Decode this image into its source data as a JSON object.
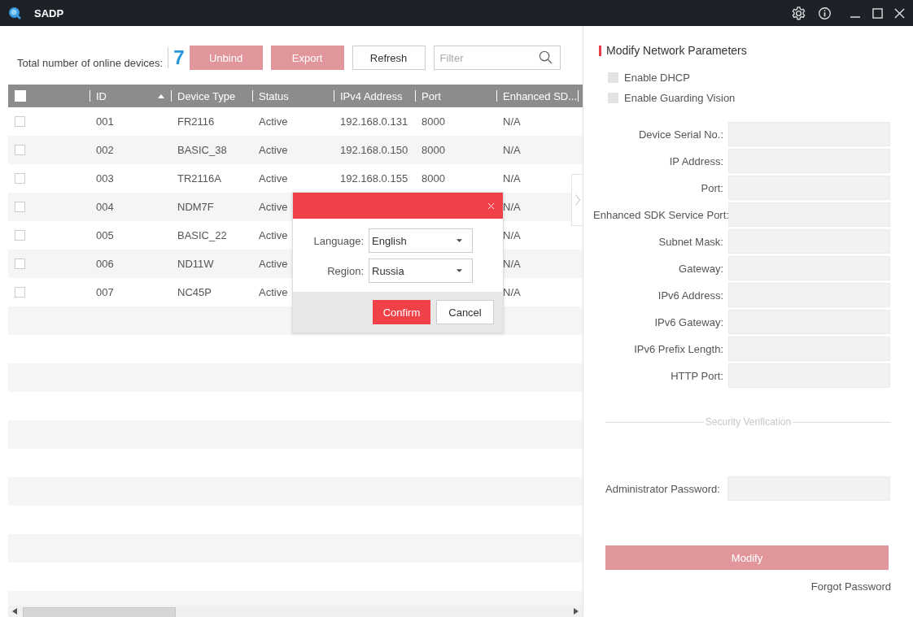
{
  "window": {
    "title": "SADP"
  },
  "toolbar": {
    "count_label": "Total number of online devices:",
    "count": "7",
    "buttons": [
      {
        "label": "Unbind",
        "disabled": true
      },
      {
        "label": "Export",
        "disabled": true
      },
      {
        "label": "Refresh",
        "disabled": false
      }
    ],
    "filter": {
      "placeholder": "Filter"
    }
  },
  "table": {
    "select_all": {
      "checked": false
    },
    "columns": [
      {
        "label": "ID",
        "sorted": true
      },
      {
        "label": "Device Type",
        "sorted": false
      },
      {
        "label": "Status",
        "sorted": false
      },
      {
        "label": "IPv4 Address",
        "sorted": false
      },
      {
        "label": "Port",
        "sorted": false
      },
      {
        "label": "Enhanced SD...",
        "sorted": false
      }
    ],
    "rows": [
      {
        "checked": false,
        "id": "001",
        "device_type": "FR2116",
        "status": "Active",
        "ipv4": "192.168.0.131",
        "port": "8000",
        "enhanced_sdk": "N/A"
      },
      {
        "checked": false,
        "id": "002",
        "device_type": "BASIC_38",
        "status": "Active",
        "ipv4": "192.168.0.150",
        "port": "8000",
        "enhanced_sdk": "N/A"
      },
      {
        "checked": false,
        "id": "003",
        "device_type": "TR2116A",
        "status": "Active",
        "ipv4": "192.168.0.155",
        "port": "8000",
        "enhanced_sdk": "N/A"
      },
      {
        "checked": false,
        "id": "004",
        "device_type": "NDM7F",
        "status": "Active",
        "enhanced_sdk": "N/A"
      },
      {
        "checked": false,
        "id": "005",
        "device_type": "BASIC_22",
        "status": "Active",
        "enhanced_sdk": "N/A"
      },
      {
        "checked": false,
        "id": "006",
        "device_type": "ND11W",
        "status": "Active",
        "enhanced_sdk": "N/A"
      },
      {
        "checked": false,
        "id": "007",
        "device_type": "NC45P",
        "status": "Active",
        "enhanced_sdk": "N/A"
      }
    ]
  },
  "dialog": {
    "fields": [
      {
        "label": "Language:",
        "value": "English"
      },
      {
        "label": "Region:",
        "value": "Russia"
      }
    ],
    "buttons": [
      {
        "label": "Confirm",
        "kind": "primary"
      },
      {
        "label": "Cancel",
        "kind": "secondary"
      }
    ]
  },
  "panel": {
    "title": "Modify Network Parameters",
    "options": [
      {
        "label": "Enable DHCP",
        "checked": false,
        "disabled": true
      },
      {
        "label": "Enable Guarding Vision",
        "checked": false,
        "disabled": true
      }
    ],
    "fields": [
      {
        "label": "Device Serial No.:"
      },
      {
        "label": "IP Address:"
      },
      {
        "label": "Port:"
      },
      {
        "label": "Enhanced SDK Service Port:"
      },
      {
        "label": "Subnet Mask:"
      },
      {
        "label": "Gateway:"
      },
      {
        "label": "IPv6 Address:"
      },
      {
        "label": "IPv6 Gateway:"
      },
      {
        "label": "IPv6 Prefix Length:"
      },
      {
        "label": "HTTP Port:"
      }
    ],
    "section": "Security Verification",
    "password_label": "Administrator Password:",
    "modify_button": {
      "label": "Modify",
      "disabled": true
    },
    "forgot_link": "Forgot Password"
  }
}
